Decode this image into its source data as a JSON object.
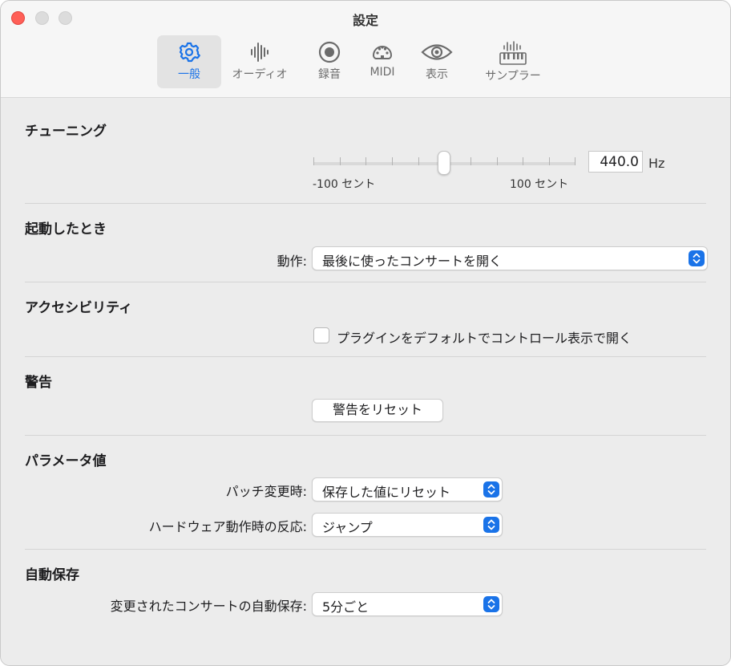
{
  "window": {
    "title": "設定"
  },
  "toolbar": {
    "tabs": [
      {
        "label": "一般",
        "icon": "gear-icon",
        "active": true
      },
      {
        "label": "オーディオ",
        "icon": "waveform-icon",
        "active": false
      },
      {
        "label": "録音",
        "icon": "record-icon",
        "active": false
      },
      {
        "label": "MIDI",
        "icon": "midi-connector-icon",
        "active": false
      },
      {
        "label": "表示",
        "icon": "eye-icon",
        "active": false
      },
      {
        "label": "サンプラー",
        "icon": "sampler-keyboard-icon",
        "active": false
      }
    ]
  },
  "tuning": {
    "title": "チューニング",
    "min_label": "-100 セント",
    "max_label": "100 セント",
    "value": "440.0",
    "unit": "Hz",
    "slider_position": 0.5
  },
  "startup": {
    "title": "起動したとき",
    "action_label": "動作:",
    "action_value": "最後に使ったコンサートを開く"
  },
  "accessibility": {
    "title": "アクセシビリティ",
    "checkbox_label": "プラグインをデフォルトでコントロール表示で開く",
    "checked": false
  },
  "warnings": {
    "title": "警告",
    "reset_button": "警告をリセット"
  },
  "parameters": {
    "title": "パラメータ値",
    "patch_change_label": "パッチ変更時:",
    "patch_change_value": "保存した値にリセット",
    "hardware_label": "ハードウェア動作時の反応:",
    "hardware_value": "ジャンプ"
  },
  "autosave": {
    "title": "自動保存",
    "label": "変更されたコンサートの自動保存:",
    "value": "5分ごと"
  },
  "colors": {
    "accent": "#1a73e8",
    "close": "#ff5f57"
  }
}
